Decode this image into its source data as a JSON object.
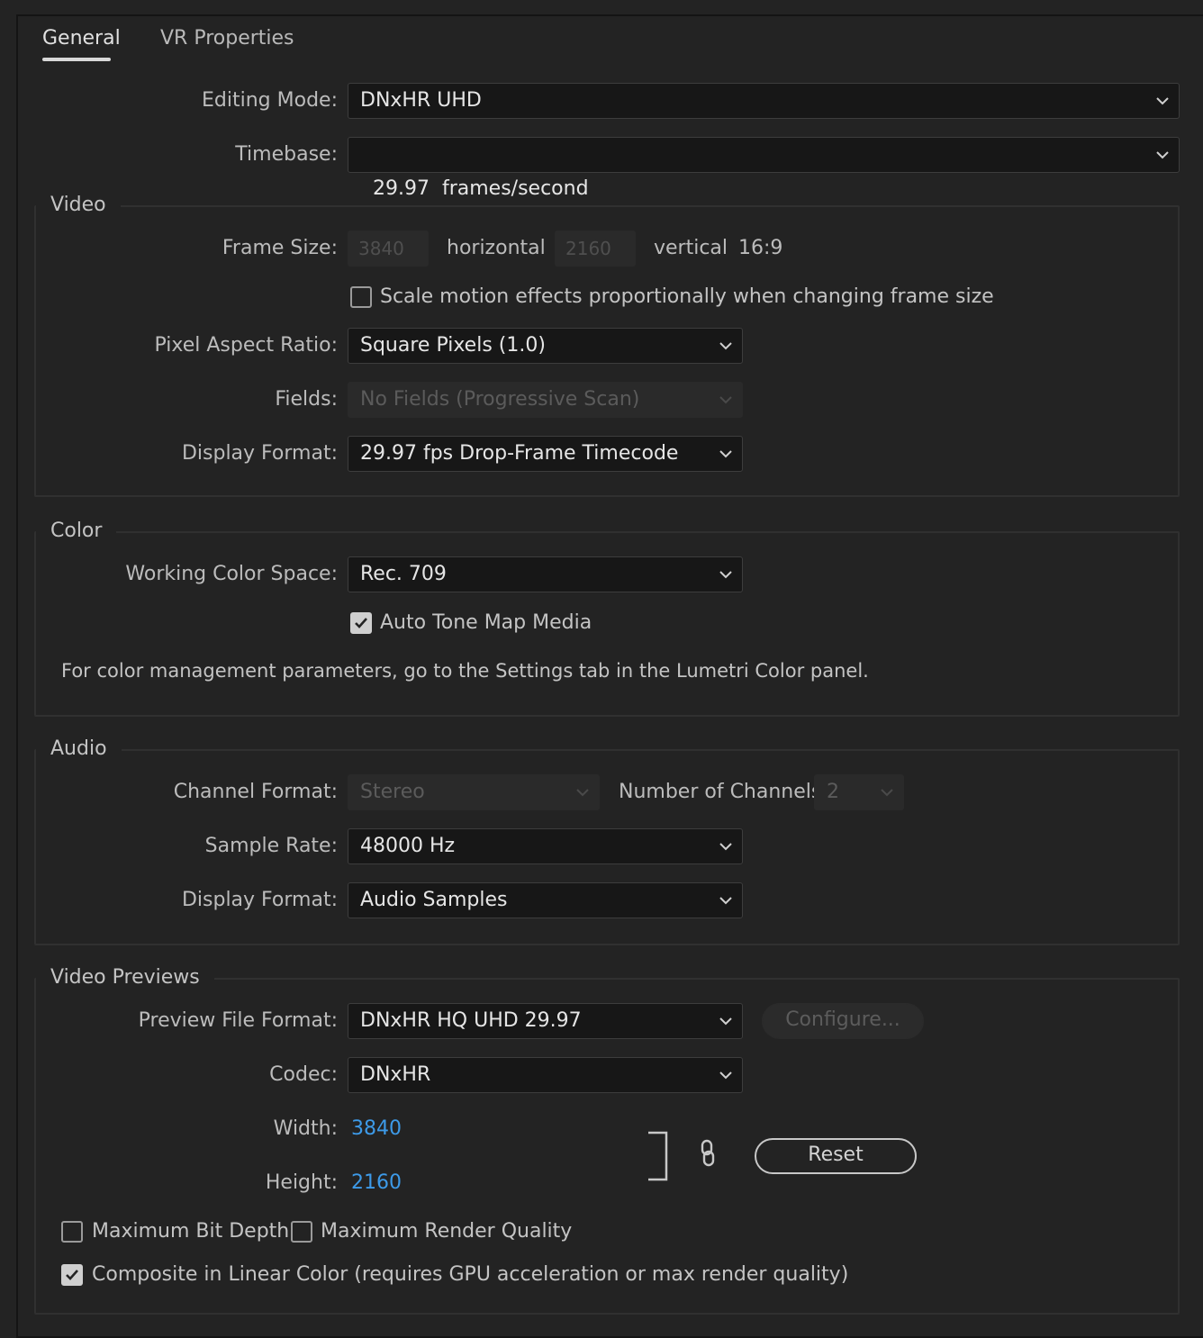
{
  "tabs": [
    {
      "label": "General",
      "active": true
    },
    {
      "label": "VR Properties",
      "active": false
    }
  ],
  "general": {
    "editing_mode_label": "Editing Mode:",
    "editing_mode_value": "DNxHR UHD",
    "timebase_label": "Timebase:",
    "timebase_value": "29.97  frames/second"
  },
  "video": {
    "title": "Video",
    "frame_size_label": "Frame Size:",
    "frame_width": "3840",
    "horizontal_label": "horizontal",
    "frame_height": "2160",
    "vertical_label": "vertical",
    "aspect": "16:9",
    "scale_motion_label": "Scale motion effects proportionally when changing frame size",
    "scale_motion_checked": false,
    "par_label": "Pixel Aspect Ratio:",
    "par_value": "Square Pixels (1.0)",
    "fields_label": "Fields:",
    "fields_value": "No Fields (Progressive Scan)",
    "display_format_label": "Display Format:",
    "display_format_value": "29.97 fps Drop-Frame Timecode"
  },
  "color": {
    "title": "Color",
    "working_space_label": "Working Color Space:",
    "working_space_value": "Rec. 709",
    "auto_tone_label": "Auto Tone Map Media",
    "auto_tone_checked": true,
    "info": "For color management parameters, go to the Settings tab in the Lumetri Color panel."
  },
  "audio": {
    "title": "Audio",
    "channel_format_label": "Channel Format:",
    "channel_format_value": "Stereo",
    "num_channels_label": "Number of Channels:",
    "num_channels_value": "2",
    "sample_rate_label": "Sample Rate:",
    "sample_rate_value": "48000 Hz",
    "display_format_label": "Display Format:",
    "display_format_value": "Audio Samples"
  },
  "previews": {
    "title": "Video Previews",
    "file_format_label": "Preview File Format:",
    "file_format_value": "DNxHR HQ UHD 29.97",
    "configure_label": "Configure...",
    "codec_label": "Codec:",
    "codec_value": "DNxHR",
    "width_label": "Width:",
    "width_value": "3840",
    "height_label": "Height:",
    "height_value": "2160",
    "reset_label": "Reset",
    "max_bit_depth_label": "Maximum Bit Depth",
    "max_bit_depth_checked": false,
    "max_render_quality_label": "Maximum Render Quality",
    "max_render_quality_checked": false,
    "composite_linear_label": "Composite in Linear Color (requires GPU acceleration or max render quality)",
    "composite_linear_checked": true
  },
  "colors": {
    "background": "#232323",
    "field_bg": "#171717",
    "link_blue": "#3d9ae8"
  }
}
